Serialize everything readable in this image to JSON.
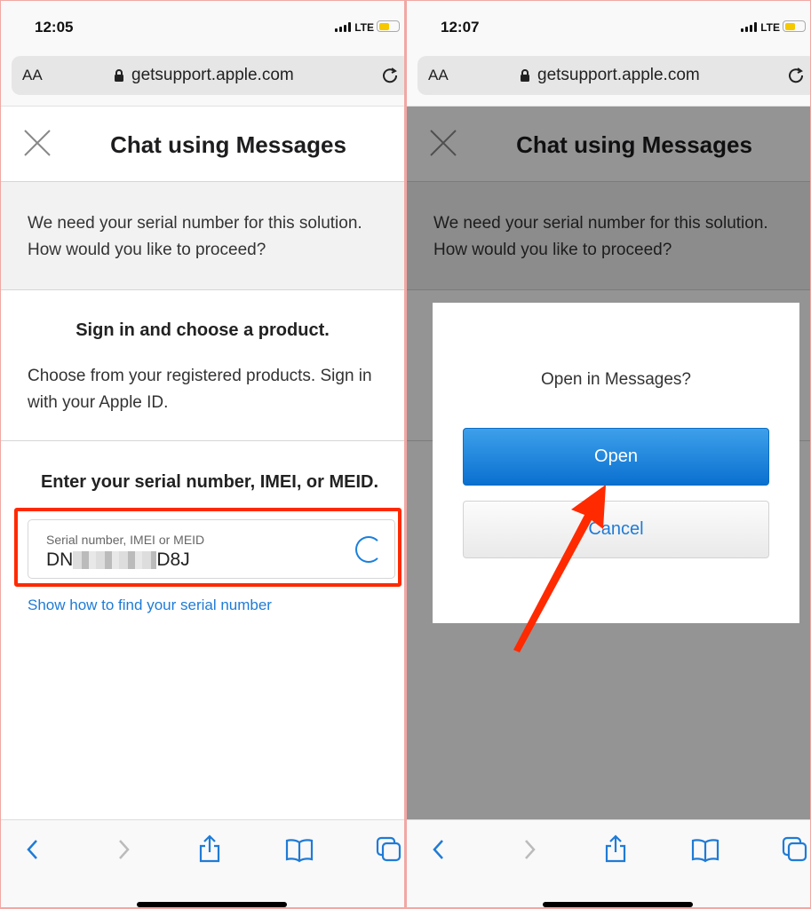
{
  "left": {
    "status": {
      "time": "12:05",
      "network": "LTE"
    },
    "browser": {
      "text_size": "AA",
      "url": "getsupport.apple.com"
    },
    "page": {
      "title": "Chat using Messages",
      "message": "We need your serial number for this solution. How would you like to proceed?",
      "signin_heading": "Sign in and choose a product.",
      "signin_text": "Choose from your registered products. Sign in with your Apple ID.",
      "serial_heading": "Enter your serial number, IMEI, or MEID.",
      "serial_label": "Serial number, IMEI or MEID",
      "serial_prefix": "DN",
      "serial_suffix": "D8J",
      "find_link": "Show how to find your serial number"
    }
  },
  "right": {
    "status": {
      "time": "12:07",
      "network": "LTE"
    },
    "browser": {
      "text_size": "AA",
      "url": "getsupport.apple.com"
    },
    "page": {
      "title": "Chat using Messages",
      "message": "We need your serial number for this solution. How would you like to proceed?"
    },
    "dialog": {
      "question": "Open in Messages?",
      "open_label": "Open",
      "cancel_label": "Cancel"
    }
  },
  "colors": {
    "accent": "#1f7bd6",
    "highlight": "#ff2a00",
    "battery": "#f5c800"
  },
  "battery_level": 0.55
}
